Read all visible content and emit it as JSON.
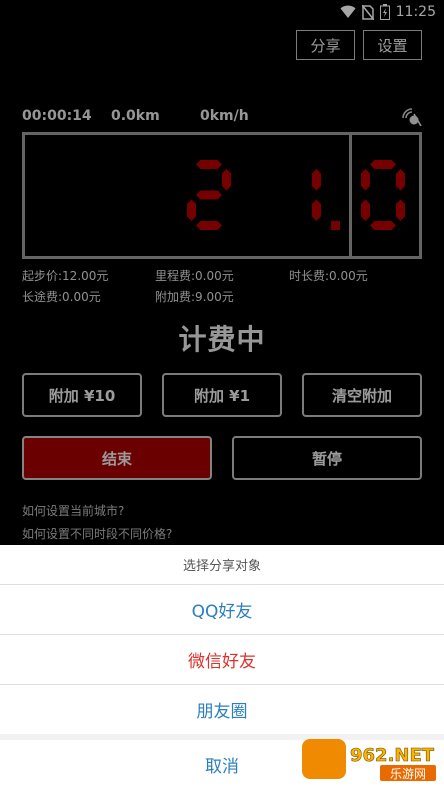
{
  "status_bar": {
    "time": "11:25",
    "icons": [
      "wifi-icon",
      "no-sim-icon",
      "battery-charging-icon"
    ]
  },
  "top_buttons": {
    "share": "分享",
    "settings": "设置"
  },
  "info": {
    "elapsed": "00:00:14",
    "distance": "0.0km",
    "speed": "0km/h",
    "signal_icon": "gps-signal-icon"
  },
  "meter": {
    "fare": "21.0",
    "digit_color": "#b50000"
  },
  "fees": {
    "start_fee": "起步价:12.00元",
    "mileage_fee": "里程费:0.00元",
    "time_fee": "时长费:0.00元",
    "long_distance_fee": "长途费:0.00元",
    "surcharge_fee": "附加费:9.00元"
  },
  "status_title": "计费中",
  "actions": {
    "add10": "附加 ¥10",
    "add1": "附加 ¥1",
    "clear": "清空附加",
    "end": "结束",
    "pause": "暂停"
  },
  "help_links": [
    "如何设置当前城市?",
    "如何设置不同时段不同价格?"
  ],
  "share_sheet": {
    "title": "选择分享对象",
    "options": [
      "QQ好友",
      "微信好友",
      "朋友圈"
    ],
    "cancel": "取消"
  },
  "watermark": {
    "text": "962.NET",
    "subtext": "乐游网"
  },
  "colors": {
    "accent_red": "#a30000",
    "link_blue": "#2b7fbf",
    "danger_red": "#e0302a"
  }
}
